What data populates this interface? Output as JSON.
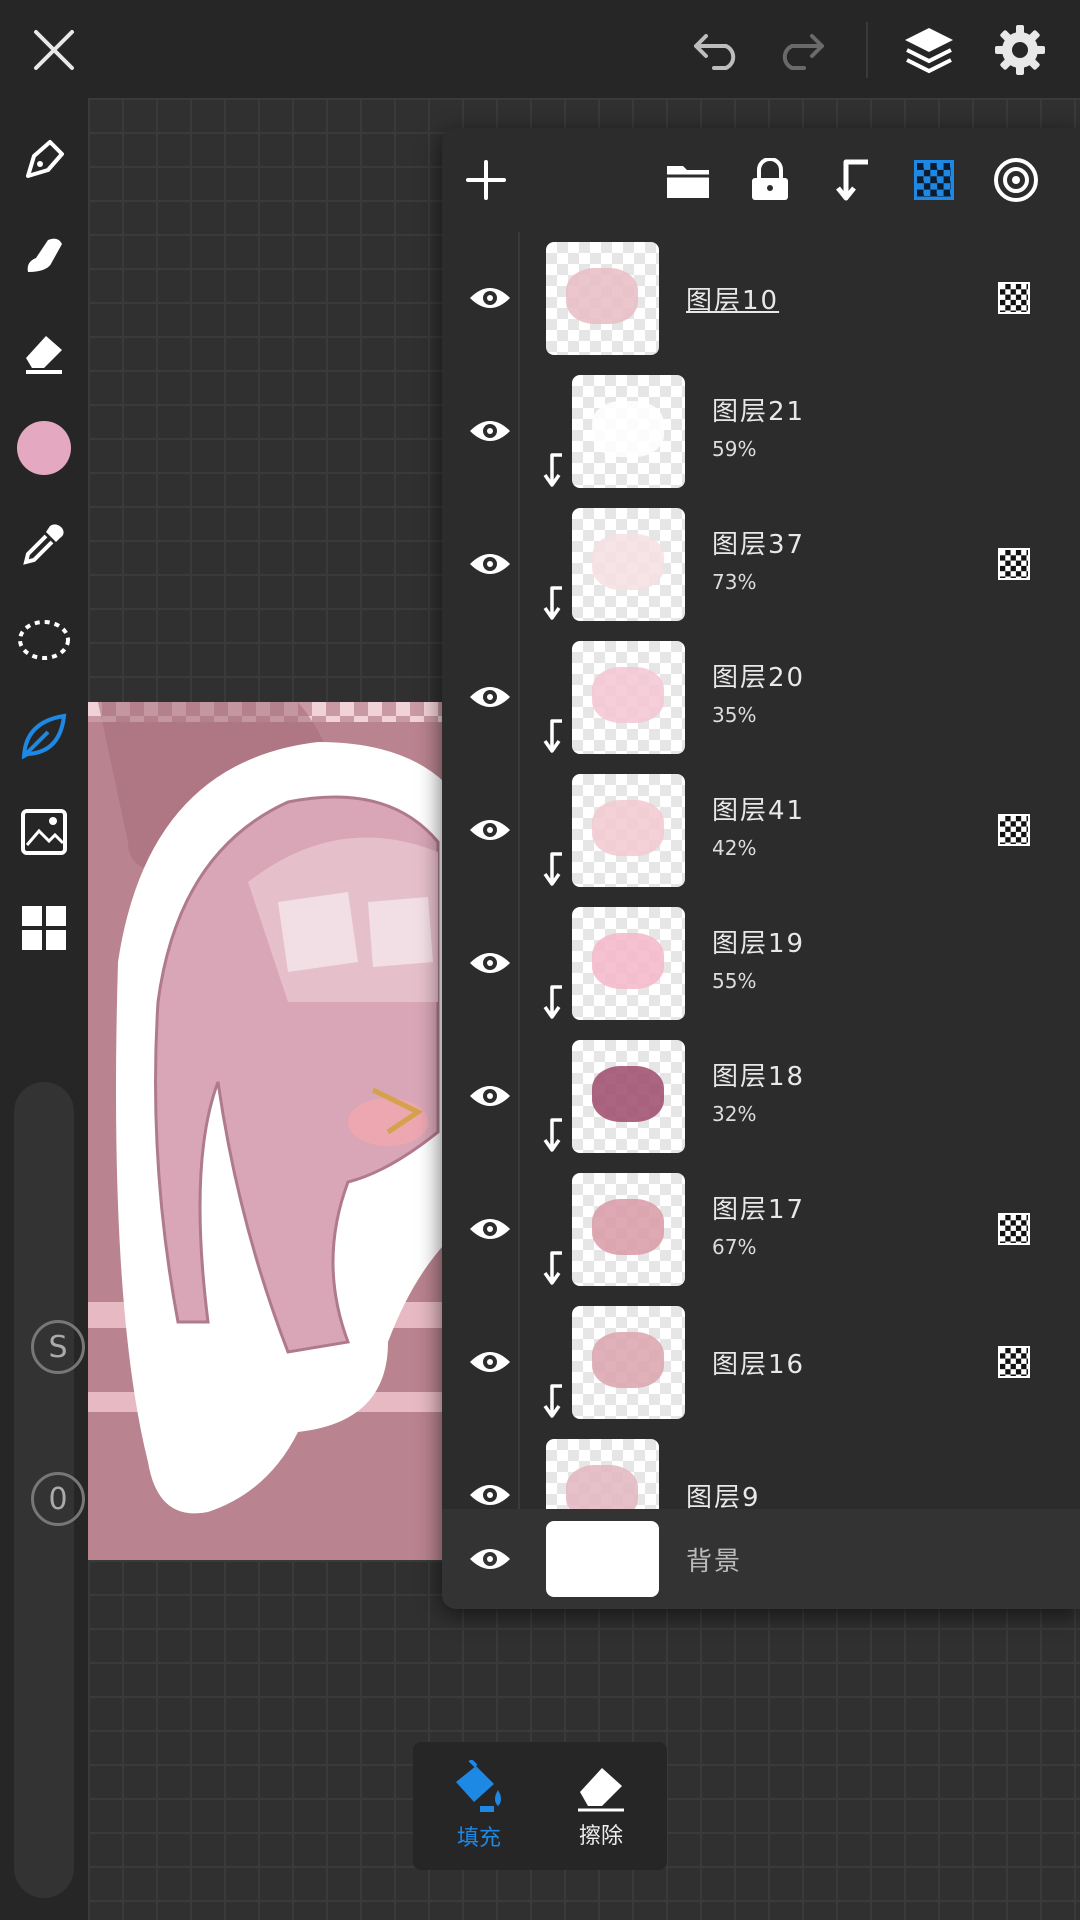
{
  "topbar": {
    "close_icon": "close-icon",
    "undo_icon": "undo-icon",
    "redo_icon": "redo-icon",
    "layers_icon": "layers-icon",
    "settings_icon": "gear-icon"
  },
  "sidebar": {
    "tools": [
      "pen-icon",
      "smudge-icon",
      "eraser-icon",
      "color-swatch",
      "eyedropper-icon",
      "lasso-icon",
      "leaf-brush-icon",
      "image-import-icon",
      "grid-icon"
    ],
    "color": "#e4a9c0",
    "active_tool_color": "#1e88e5",
    "size_value": "S",
    "opacity_value": "0"
  },
  "layers_toolbar": {
    "icons": [
      "add-icon",
      "folder-icon",
      "lock-icon",
      "clip-icon",
      "alpha-lock-icon",
      "target-icon"
    ],
    "accent": "#1e88e5"
  },
  "layers": [
    {
      "name": "图层10",
      "opacity": "",
      "clipped": false,
      "blend": true,
      "thumb_color": "#e7bcc4"
    },
    {
      "name": "图层21",
      "opacity": "59%",
      "clipped": true,
      "blend": false,
      "thumb_color": "#ffffff"
    },
    {
      "name": "图层37",
      "opacity": "73%",
      "clipped": true,
      "blend": true,
      "thumb_color": "#f6dfe3"
    },
    {
      "name": "图层20",
      "opacity": "35%",
      "clipped": true,
      "blend": false,
      "thumb_color": "#f4c6d2"
    },
    {
      "name": "图层41",
      "opacity": "42%",
      "clipped": true,
      "blend": true,
      "thumb_color": "#f1c9d0"
    },
    {
      "name": "图层19",
      "opacity": "55%",
      "clipped": true,
      "blend": false,
      "thumb_color": "#f4b7ca"
    },
    {
      "name": "图层18",
      "opacity": "32%",
      "clipped": true,
      "blend": false,
      "thumb_color": "#9c4a6a"
    },
    {
      "name": "图层17",
      "opacity": "67%",
      "clipped": true,
      "blend": true,
      "thumb_color": "#d99aa6"
    },
    {
      "name": "图层16",
      "opacity": "",
      "clipped": true,
      "blend": true,
      "thumb_color": "#dba3ac"
    },
    {
      "name": "图层9",
      "opacity": "",
      "clipped": false,
      "blend": false,
      "thumb_color": "#e3b6bf"
    }
  ],
  "background_layer": {
    "name": "背景"
  },
  "bottom_tools": {
    "fill_label": "填充",
    "erase_label": "擦除"
  }
}
